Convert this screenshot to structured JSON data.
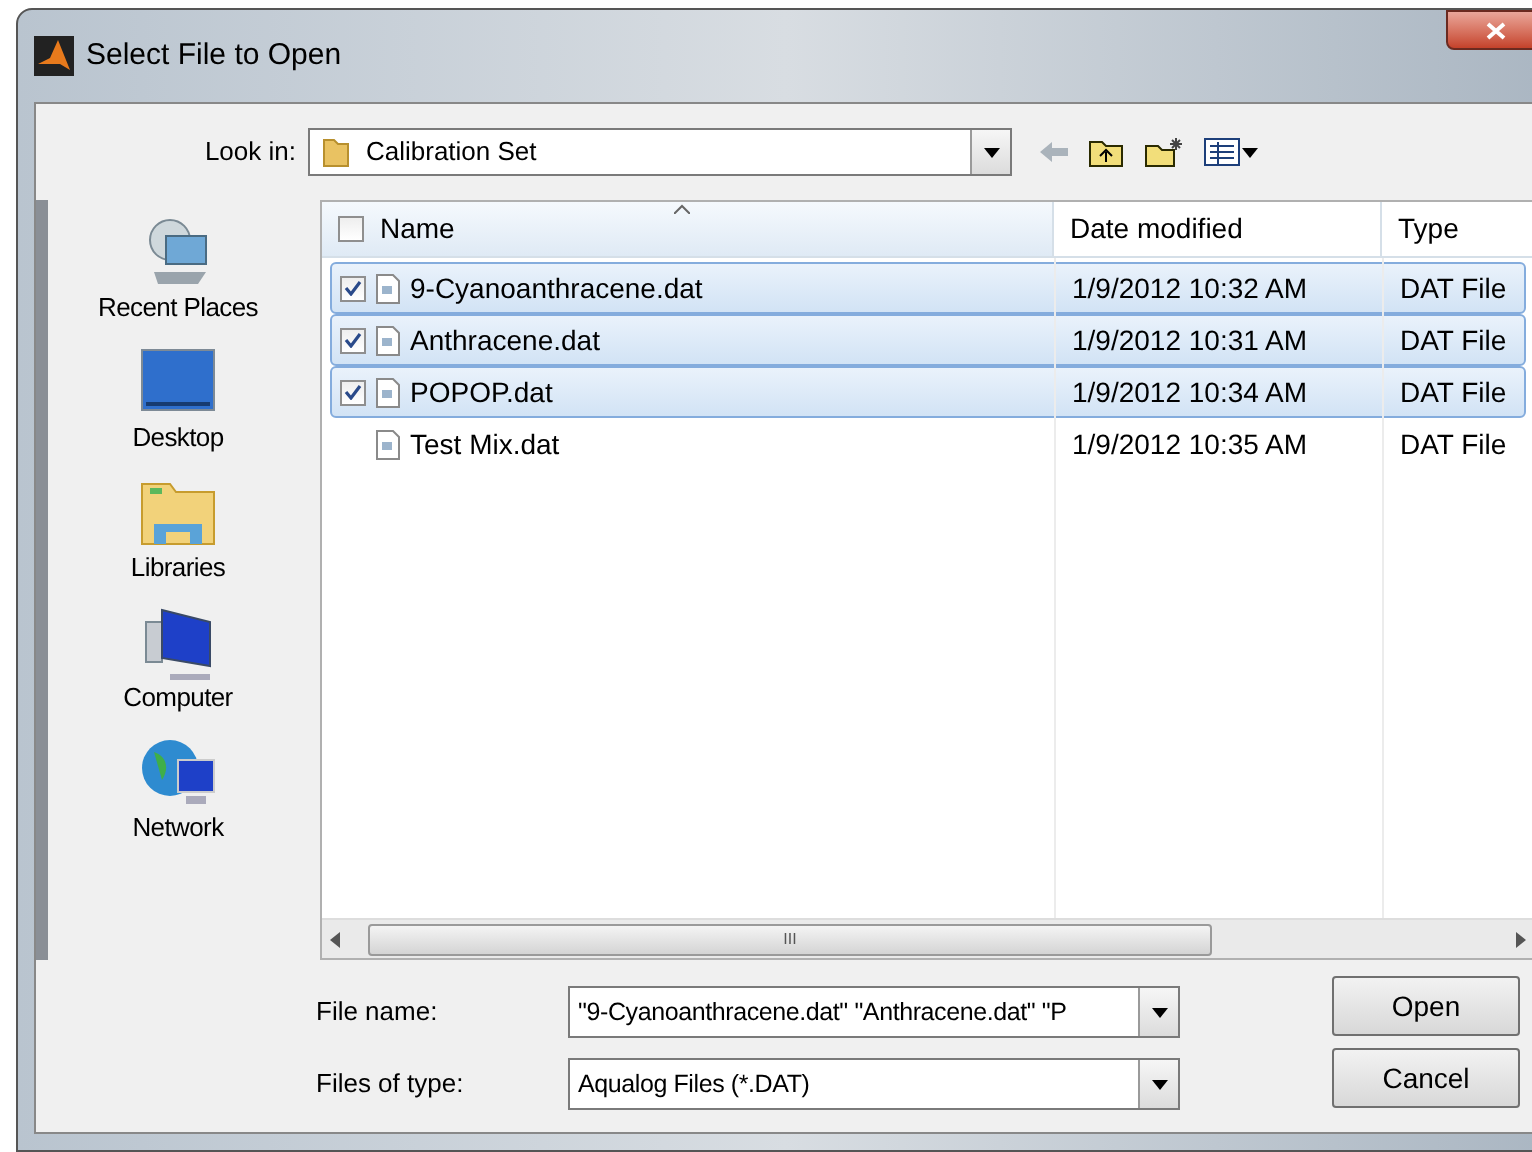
{
  "window": {
    "title": "Select File to Open"
  },
  "look_in": {
    "label": "Look in:",
    "value": "Calibration Set"
  },
  "places": [
    {
      "label": "Recent Places",
      "kind": "recent"
    },
    {
      "label": "Desktop",
      "kind": "desktop"
    },
    {
      "label": "Libraries",
      "kind": "libraries"
    },
    {
      "label": "Computer",
      "kind": "computer"
    },
    {
      "label": "Network",
      "kind": "network"
    }
  ],
  "table": {
    "select_all": {
      "checked": false
    },
    "columns": [
      "Name",
      "Date modified",
      "Type"
    ],
    "rows": [
      {
        "name": "9-Cyanoanthracene.dat",
        "date": "1/9/2012 10:32 AM",
        "type": "DAT File",
        "selected": true,
        "checked": true
      },
      {
        "name": "Anthracene.dat",
        "date": "1/9/2012 10:31 AM",
        "type": "DAT File",
        "selected": true,
        "checked": true
      },
      {
        "name": "POPOP.dat",
        "date": "1/9/2012 10:34 AM",
        "type": "DAT File",
        "selected": true,
        "checked": true
      },
      {
        "name": "Test Mix.dat",
        "date": "1/9/2012 10:35 AM",
        "type": "DAT File",
        "selected": false,
        "checked": false
      }
    ]
  },
  "scrollbar_grip": "III",
  "file_name": {
    "label": "File name:",
    "value": "\"9-Cyanoanthracene.dat\" \"Anthracene.dat\" \"P"
  },
  "file_type": {
    "label": "Files of type:",
    "value": "Aqualog Files (*.DAT)"
  },
  "buttons": [
    "Open",
    "Cancel"
  ]
}
